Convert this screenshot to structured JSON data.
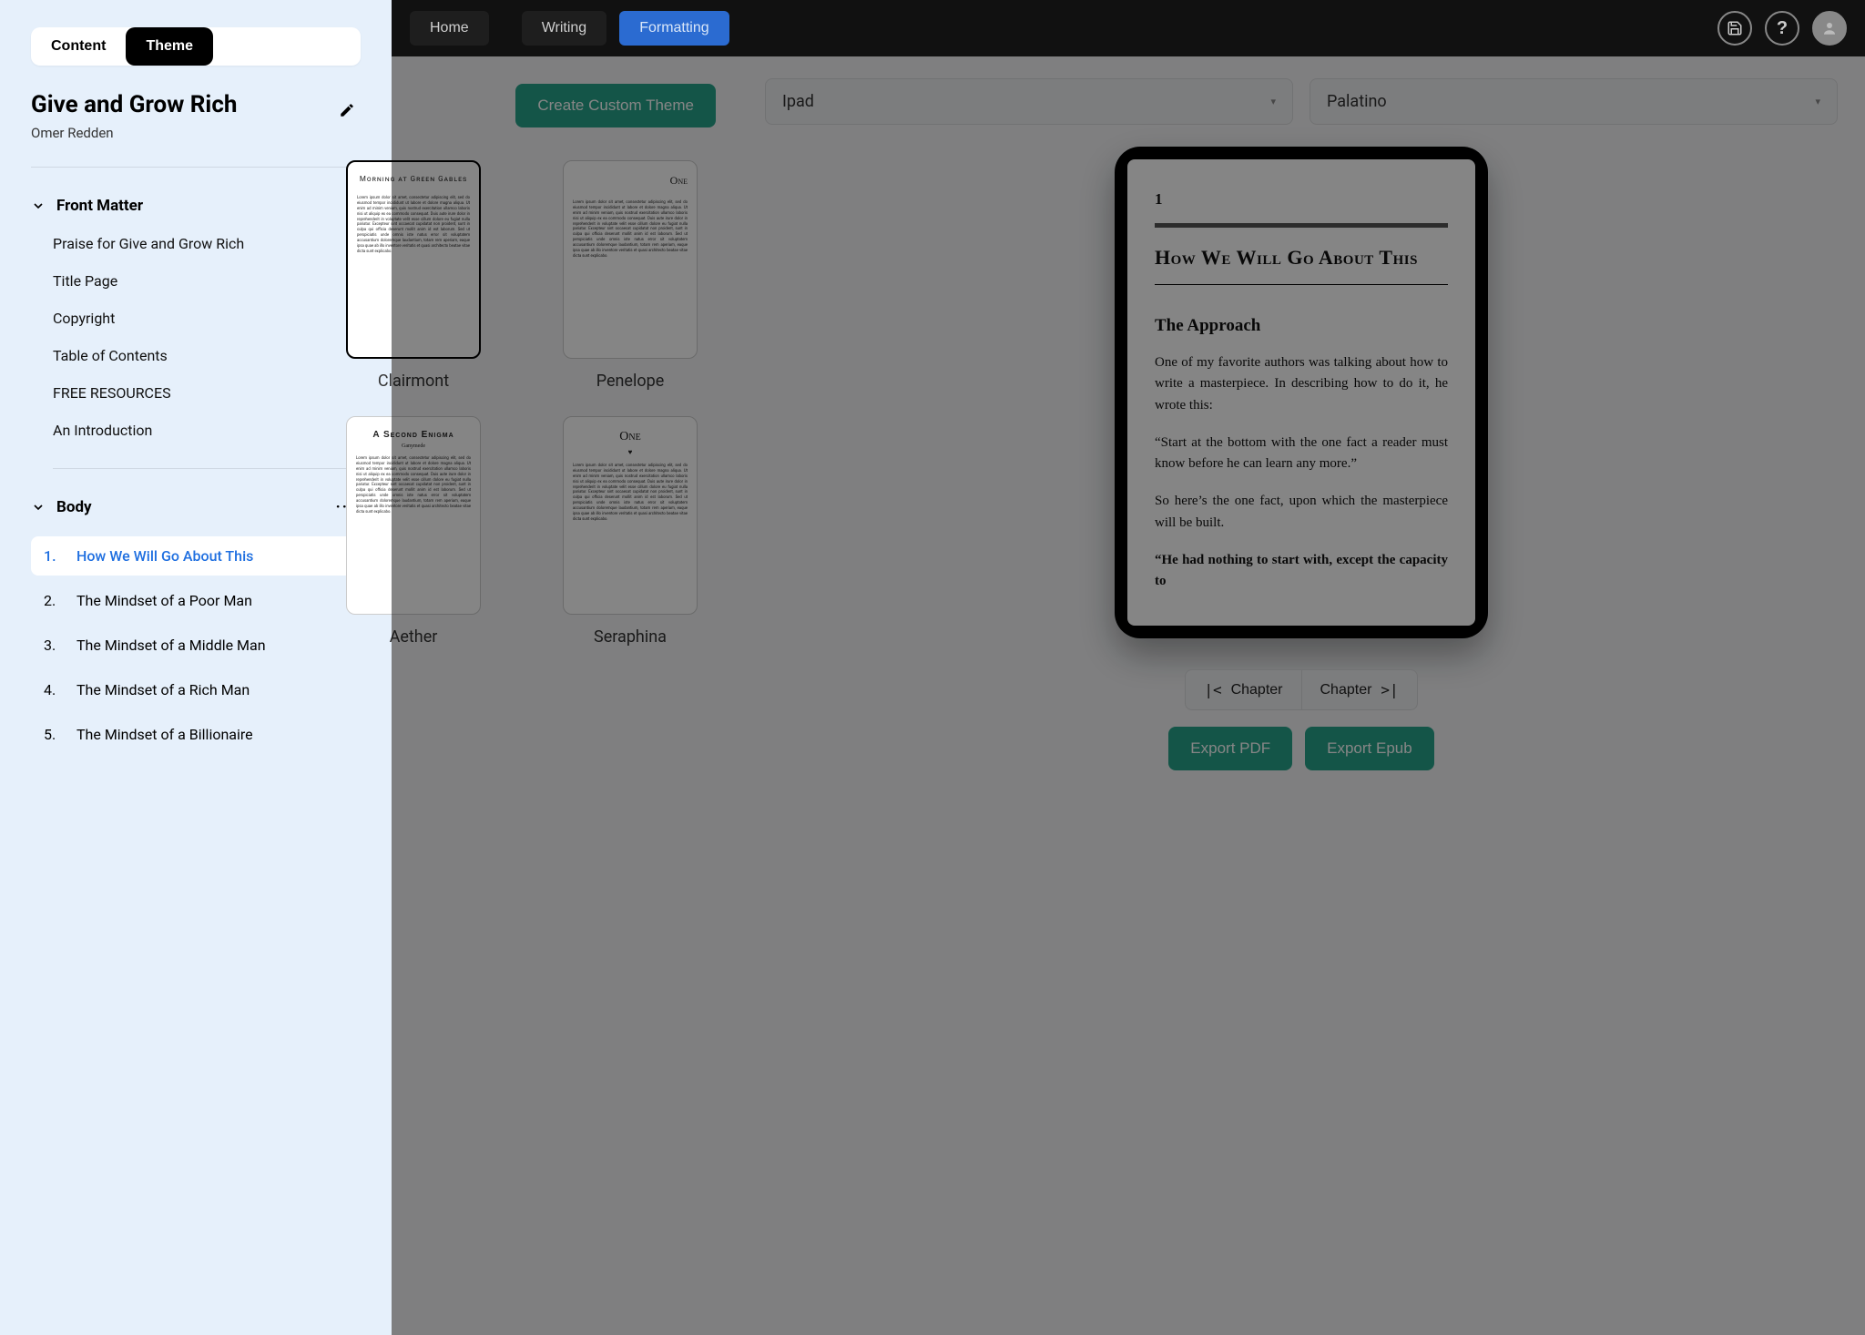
{
  "sidebar": {
    "tabs": {
      "content": "Content",
      "theme": "Theme"
    },
    "book": {
      "title": "Give and Grow Rich",
      "author": "Omer Redden"
    },
    "front_matter": {
      "label": "Front Matter",
      "items": [
        "Praise for Give and Grow Rich",
        "Title Page",
        "Copyright",
        "Table of Contents",
        "FREE RESOURCES",
        "An Introduction"
      ]
    },
    "body": {
      "label": "Body",
      "items": [
        {
          "n": "1.",
          "title": "How We Will Go About This",
          "active": true
        },
        {
          "n": "2.",
          "title": "The Mindset of a Poor Man"
        },
        {
          "n": "3.",
          "title": "The Mindset of a Middle Man"
        },
        {
          "n": "4.",
          "title": "The Mindset of a Rich Man"
        },
        {
          "n": "5.",
          "title": "The Mindset of a Billionaire"
        }
      ]
    }
  },
  "topbar": {
    "home": "Home",
    "writing": "Writing",
    "formatting": "Formatting"
  },
  "themes": {
    "create": "Create Custom Theme",
    "cards": [
      {
        "label": "Clairmont",
        "title": "Morning at Green Gables",
        "title_class": ""
      },
      {
        "label": "Penelope",
        "title": "One",
        "title_class": "right"
      },
      {
        "label": "Aether",
        "title": "A Second Enigma",
        "title_class": "sans",
        "sub": "Ganymede"
      },
      {
        "label": "Seraphina",
        "title": "One",
        "title_class": "script",
        "heart": "♥"
      }
    ]
  },
  "preview": {
    "device": "Ipad",
    "font": "Palatino",
    "chap_num": "1",
    "chap_title": "How We Will Go About This",
    "section": "The Approach",
    "p1": "One of my favorite authors was talking about how to write a masterpiece. In describing how to do it, he wrote this:",
    "p2": "“Start at the bottom with the one fact a reader must know before he can learn any more.”",
    "p3": "So here’s the one fact, upon which the masterpiece will be built.",
    "p4": "“He had nothing to start with, except the capacity to",
    "prev": "Chapter",
    "next": "Chapter",
    "export_pdf": "Export PDF",
    "export_epub": "Export Epub"
  },
  "lorem": "Lorem ipsum dolor sit amet, consectetur adipiscing elit, sed do eiusmod tempor incididunt ut labore et dolore magna aliqua. Ut enim ad minim veniam, quis nostrud exercitation ullamco laboris nisi ut aliquip ex ea commodo consequat. Duis aute irure dolor in reprehenderit in voluptate velit esse cillum dolore eu fugiat nulla pariatur. Excepteur sint occaecat cupidatat non proident, sunt in culpa qui officia deserunt mollit anim id est laborum. Sed ut perspiciatis unde omnis iste natus error sit voluptatem accusantium doloremque laudantium, totam rem aperiam, eaque ipsa quae ab illo inventore veritatis et quasi architecto beatae vitae dicta sunt explicabo."
}
